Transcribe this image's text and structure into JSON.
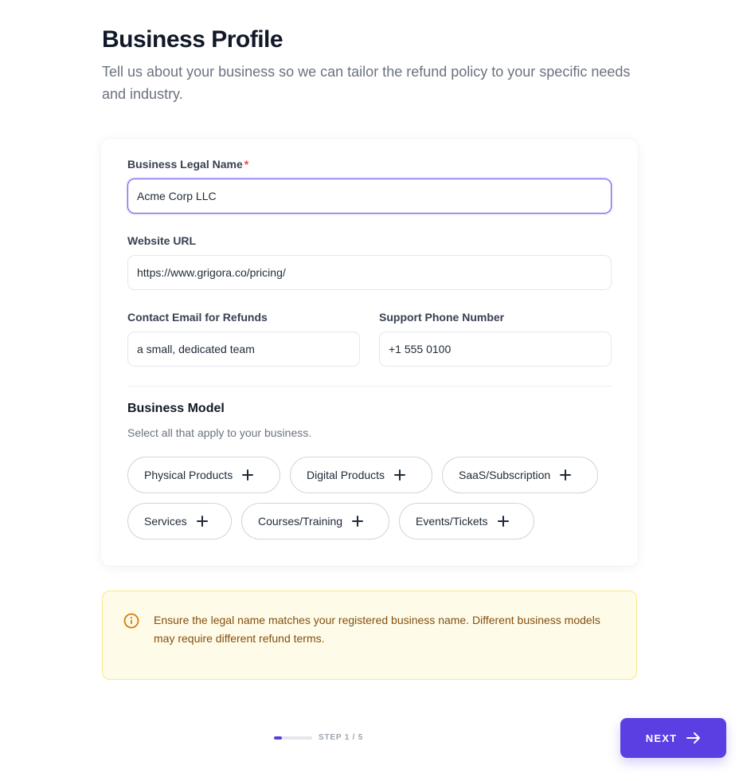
{
  "header": {
    "title": "Business Profile",
    "subtitle": "Tell us about your business so we can tailor the refund policy to your specific needs and industry."
  },
  "form": {
    "legal_name": {
      "label": "Business Legal Name",
      "required_mark": "*",
      "value": "Acme Corp LLC"
    },
    "website": {
      "label": "Website URL",
      "value": "https://www.grigora.co/pricing/"
    },
    "email": {
      "label": "Contact Email for Refunds",
      "value": "a small, dedicated team"
    },
    "phone": {
      "label": "Support Phone Number",
      "value": "+1 555 0100"
    }
  },
  "business_model": {
    "title": "Business Model",
    "subtitle": "Select all that apply to your business.",
    "options": [
      "Physical Products",
      "Digital Products",
      "SaaS/Subscription",
      "Services",
      "Courses/Training",
      "Events/Tickets"
    ]
  },
  "notice": {
    "text": "Ensure the legal name matches your registered business name. Different business models may require different refund terms.",
    "icon": "info-icon"
  },
  "footer": {
    "step_label": "STEP 1 / 5",
    "progress_fraction": 0.2,
    "next_label": "NEXT"
  },
  "colors": {
    "accent": "#5b3fe3",
    "notice_bg": "#fefce8",
    "notice_border": "#fde68a",
    "required": "#ef4444"
  }
}
